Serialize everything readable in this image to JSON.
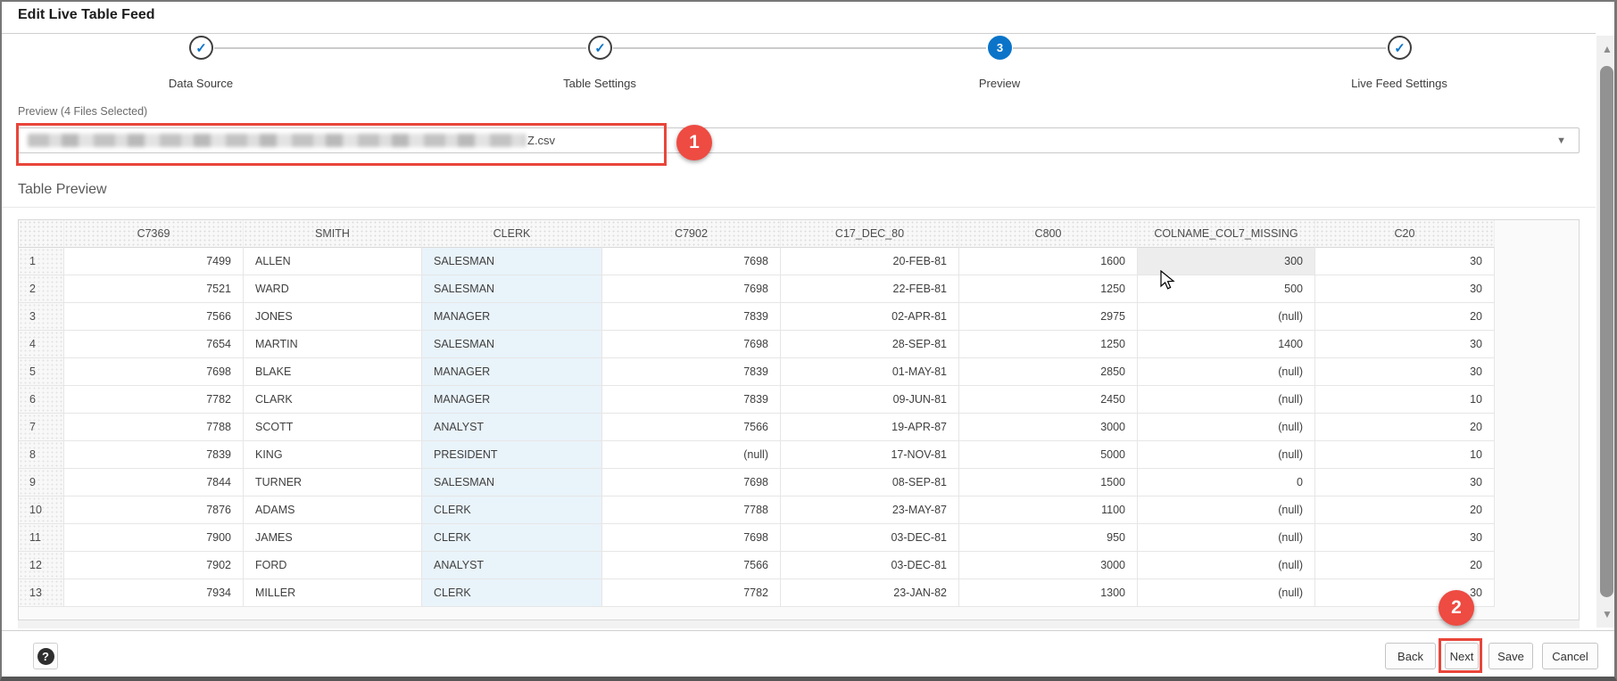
{
  "window": {
    "title": "Edit Live Table Feed"
  },
  "stepper": {
    "steps": [
      {
        "label": "Data Source",
        "state": "done",
        "glyph": "check"
      },
      {
        "label": "Table Settings",
        "state": "done",
        "glyph": "check"
      },
      {
        "label": "Preview",
        "state": "current",
        "glyph": "3"
      },
      {
        "label": "Live Feed Settings",
        "state": "done",
        "glyph": "check"
      }
    ]
  },
  "preview": {
    "label": "Preview (4 Files Selected)",
    "selected_file_visible_text": "Z.csv",
    "file_redacted": true,
    "chevron_icon": "▼"
  },
  "annotations": {
    "badge1": "1",
    "badge2": "2",
    "accent_color": "#e9453a"
  },
  "table_preview": {
    "heading": "Table Preview",
    "columns": [
      "",
      "C7369",
      "SMITH",
      "CLERK",
      "C7902",
      "C17_DEC_80",
      "C800",
      "COLNAME_COL7_MISSING",
      "C20"
    ],
    "highlighted_column": "CLERK",
    "hovered_cell": {
      "row": 1,
      "column": "COLNAME_COL7_MISSING"
    },
    "rows": [
      [
        "1",
        "7499",
        "ALLEN",
        "SALESMAN",
        "7698",
        "20-FEB-81",
        "1600",
        "300",
        "30"
      ],
      [
        "2",
        "7521",
        "WARD",
        "SALESMAN",
        "7698",
        "22-FEB-81",
        "1250",
        "500",
        "30"
      ],
      [
        "3",
        "7566",
        "JONES",
        "MANAGER",
        "7839",
        "02-APR-81",
        "2975",
        "(null)",
        "20"
      ],
      [
        "4",
        "7654",
        "MARTIN",
        "SALESMAN",
        "7698",
        "28-SEP-81",
        "1250",
        "1400",
        "30"
      ],
      [
        "5",
        "7698",
        "BLAKE",
        "MANAGER",
        "7839",
        "01-MAY-81",
        "2850",
        "(null)",
        "30"
      ],
      [
        "6",
        "7782",
        "CLARK",
        "MANAGER",
        "7839",
        "09-JUN-81",
        "2450",
        "(null)",
        "10"
      ],
      [
        "7",
        "7788",
        "SCOTT",
        "ANALYST",
        "7566",
        "19-APR-87",
        "3000",
        "(null)",
        "20"
      ],
      [
        "8",
        "7839",
        "KING",
        "PRESIDENT",
        "(null)",
        "17-NOV-81",
        "5000",
        "(null)",
        "10"
      ],
      [
        "9",
        "7844",
        "TURNER",
        "SALESMAN",
        "7698",
        "08-SEP-81",
        "1500",
        "0",
        "30"
      ],
      [
        "10",
        "7876",
        "ADAMS",
        "CLERK",
        "7788",
        "23-MAY-87",
        "1100",
        "(null)",
        "20"
      ],
      [
        "11",
        "7900",
        "JAMES",
        "CLERK",
        "7698",
        "03-DEC-81",
        "950",
        "(null)",
        "30"
      ],
      [
        "12",
        "7902",
        "FORD",
        "ANALYST",
        "7566",
        "03-DEC-81",
        "3000",
        "(null)",
        "20"
      ],
      [
        "13",
        "7934",
        "MILLER",
        "CLERK",
        "7782",
        "23-JAN-82",
        "1300",
        "(null)",
        "30"
      ]
    ]
  },
  "scrollbar": {
    "up_icon": "▲",
    "down_icon": "▼"
  },
  "footer": {
    "help_label": "?",
    "buttons": [
      {
        "label": "Back"
      },
      {
        "label": "Next",
        "annotated": true
      },
      {
        "label": "Save"
      },
      {
        "label": "Cancel"
      }
    ]
  }
}
